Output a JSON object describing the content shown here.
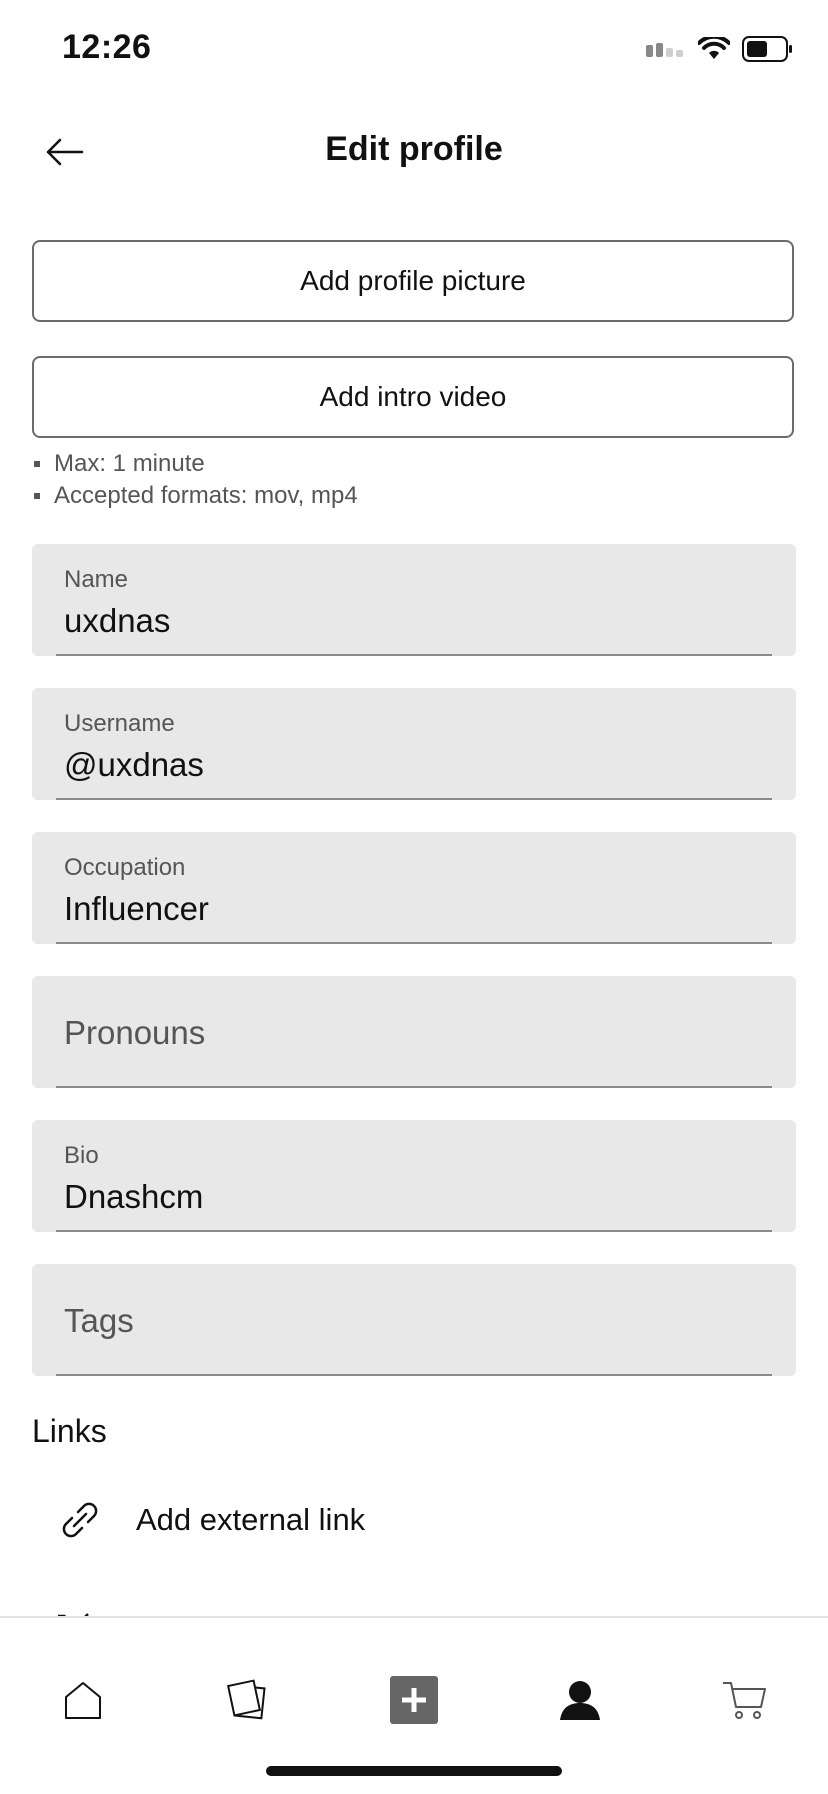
{
  "status_bar": {
    "time": "12:26"
  },
  "header": {
    "title": "Edit profile"
  },
  "actions": {
    "add_profile_picture": "Add profile picture",
    "add_intro_video": "Add intro video"
  },
  "video_hints": [
    "Max: 1 minute",
    "Accepted formats: mov, mp4"
  ],
  "fields": {
    "name": {
      "label": "Name",
      "value": "uxdnas"
    },
    "username": {
      "label": "Username",
      "value": "@uxdnas"
    },
    "occupation": {
      "label": "Occupation",
      "value": "Influencer"
    },
    "pronouns": {
      "placeholder": "Pronouns"
    },
    "bio": {
      "label": "Bio",
      "value": "Dnashcm"
    },
    "tags": {
      "placeholder": "Tags"
    }
  },
  "links": {
    "section_title": "Links",
    "add_label": "Add external link"
  },
  "bottom_nav": {
    "items": [
      "home-icon",
      "collections-icon",
      "create-icon",
      "profile-icon",
      "cart-icon"
    ],
    "active": "profile-icon"
  }
}
